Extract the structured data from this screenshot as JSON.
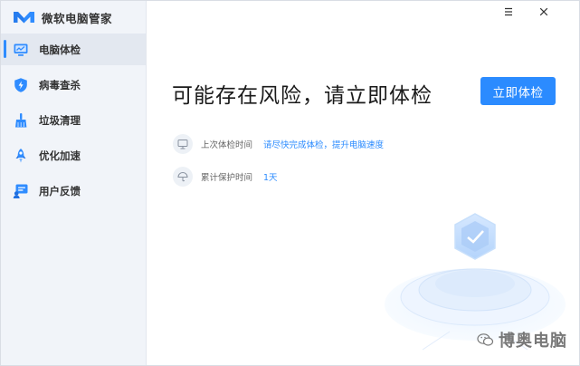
{
  "app": {
    "title": "微软电脑管家",
    "accent_color": "#2b8bff"
  },
  "sidebar": {
    "items": [
      {
        "label": "电脑体检",
        "icon": "monitor-icon",
        "active": true
      },
      {
        "label": "病毒查杀",
        "icon": "shield-icon",
        "active": false
      },
      {
        "label": "垃圾清理",
        "icon": "broom-icon",
        "active": false
      },
      {
        "label": "优化加速",
        "icon": "rocket-icon",
        "active": false
      },
      {
        "label": "用户反馈",
        "icon": "feedback-icon",
        "active": false
      }
    ]
  },
  "window_controls": {
    "menu": "menu-icon",
    "close": "close-icon"
  },
  "main": {
    "headline": "可能存在风险，请立即体检",
    "check_button": "立即体检",
    "last_check": {
      "label": "上次体检时间",
      "value": "请尽快完成体检，提升电脑速度",
      "icon": "screen-icon"
    },
    "protection": {
      "label": "累计保护时间",
      "value": "1天",
      "icon": "umbrella-icon"
    }
  },
  "watermark": {
    "text": "博奥电脑"
  }
}
